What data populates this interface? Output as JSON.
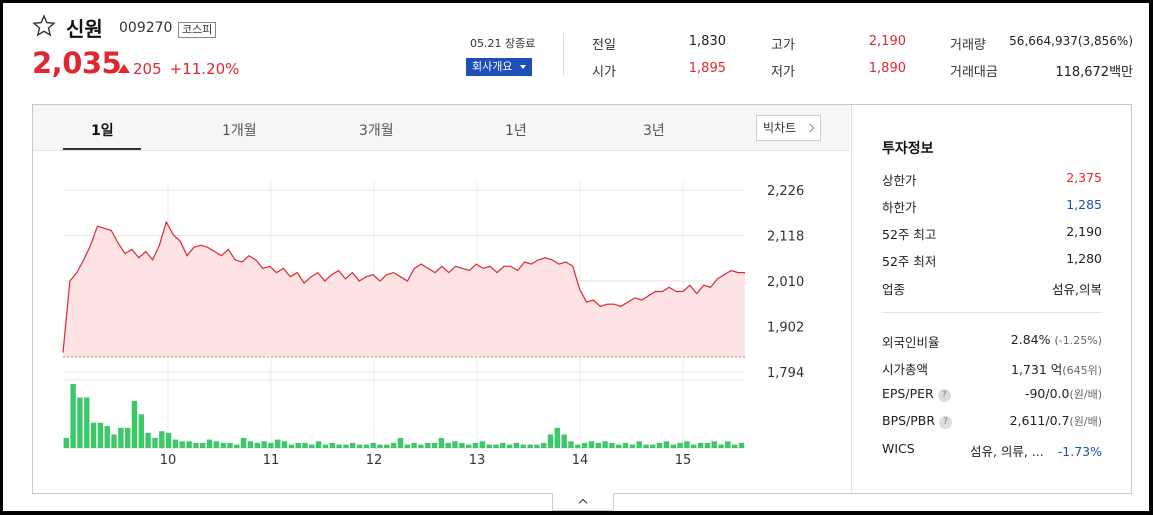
{
  "stock": {
    "name": "신원",
    "code": "009270",
    "market": "코스피",
    "price": "2,035",
    "change": "205",
    "change_pct": "+11.20%",
    "date_status": "05.21 장종료",
    "company_btn": "회사개요"
  },
  "quote": {
    "prev_close_label": "전일",
    "prev_close": "1,830",
    "open_label": "시가",
    "open": "1,895",
    "high_label": "고가",
    "high": "2,190",
    "low_label": "저가",
    "low": "1,890",
    "volume_label": "거래량",
    "volume": "56,664,937(3,856%)",
    "amount_label": "거래대금",
    "amount": "118,672백만"
  },
  "tabs": [
    "1일",
    "1개월",
    "3개월",
    "1년",
    "3년"
  ],
  "big_chart_label": "빅차트",
  "chart_data": {
    "type": "line",
    "y_ticks": [
      "2,226",
      "2,118",
      "2,010",
      "1,902",
      "1,794"
    ],
    "ylim": [
      1794,
      2226
    ],
    "x_ticks": [
      "10",
      "11",
      "12",
      "13",
      "14",
      "15"
    ],
    "prev_close": 1830,
    "price_series": [
      1840,
      2010,
      2030,
      2060,
      2095,
      2140,
      2135,
      2130,
      2100,
      2075,
      2085,
      2065,
      2080,
      2060,
      2095,
      2150,
      2120,
      2105,
      2070,
      2090,
      2095,
      2090,
      2080,
      2070,
      2085,
      2060,
      2055,
      2070,
      2060,
      2040,
      2045,
      2030,
      2040,
      2020,
      2030,
      2005,
      2020,
      2030,
      2010,
      2025,
      2035,
      2015,
      2030,
      2010,
      2020,
      2025,
      2010,
      2025,
      2030,
      2020,
      2010,
      2040,
      2050,
      2040,
      2030,
      2045,
      2030,
      2045,
      2040,
      2035,
      2050,
      2040,
      2045,
      2030,
      2045,
      2045,
      2035,
      2055,
      2050,
      2060,
      2065,
      2060,
      2050,
      2055,
      2045,
      1990,
      1960,
      1965,
      1950,
      1955,
      1955,
      1950,
      1960,
      1970,
      1965,
      1975,
      1985,
      1985,
      1995,
      1985,
      1985,
      2000,
      1980,
      2000,
      1995,
      2015,
      2025,
      2035,
      2030,
      2030
    ],
    "volume_series": [
      6,
      38,
      30,
      30,
      15,
      15,
      13,
      8,
      12,
      12,
      28,
      20,
      9,
      6,
      10,
      9,
      5,
      4,
      4,
      3,
      3,
      5,
      4,
      3,
      3,
      2,
      6,
      4,
      3,
      4,
      3,
      5,
      4,
      2,
      3,
      3,
      2,
      4,
      2,
      3,
      2,
      2,
      3,
      2,
      2,
      3,
      2,
      2,
      3,
      6,
      2,
      3,
      2,
      3,
      3,
      6,
      3,
      4,
      3,
      2,
      3,
      4,
      2,
      2,
      3,
      2,
      3,
      2,
      2,
      2,
      3,
      8,
      12,
      8,
      4,
      2,
      3,
      4,
      3,
      4,
      3,
      2,
      3,
      2,
      4,
      2,
      2,
      3,
      4,
      2,
      3,
      4,
      2,
      3,
      3,
      4,
      2,
      4,
      2,
      3
    ],
    "title": "",
    "xlabel": "",
    "ylabel": "",
    "line_color": "#e0262e",
    "area_color": "#fde3e3",
    "volume_color": "#3dc86a"
  },
  "info": {
    "title": "투자정보",
    "rows": [
      {
        "label": "상한가",
        "value": "2,375"
      },
      {
        "label": "하한가",
        "value": "1,285"
      },
      {
        "label": "52주 최고",
        "value": "2,190"
      },
      {
        "label": "52주 최저",
        "value": "1,280"
      },
      {
        "label": "업종",
        "value": "섬유,의복"
      }
    ],
    "foreign_label": "외국인비율",
    "foreign_value": "2.84%",
    "foreign_sub": "(-1.25%)",
    "mcap_label": "시가총액",
    "mcap_value": "1,731 억",
    "mcap_sub": "(645위)",
    "eps_label": "EPS/PER",
    "eps_value": "-90/0.0",
    "eps_sub": "(원/배)",
    "bps_label": "BPS/PBR",
    "bps_value": "2,611/0.7",
    "bps_sub": "(원/배)",
    "wics_label": "WICS",
    "wics_value": "섬유, 의류, ...",
    "wics_pct": "-1.73%",
    "help_mark": "?"
  },
  "colors": {
    "up": "#e0262e",
    "down": "#1e4fb8",
    "button": "#1e4fb8"
  }
}
